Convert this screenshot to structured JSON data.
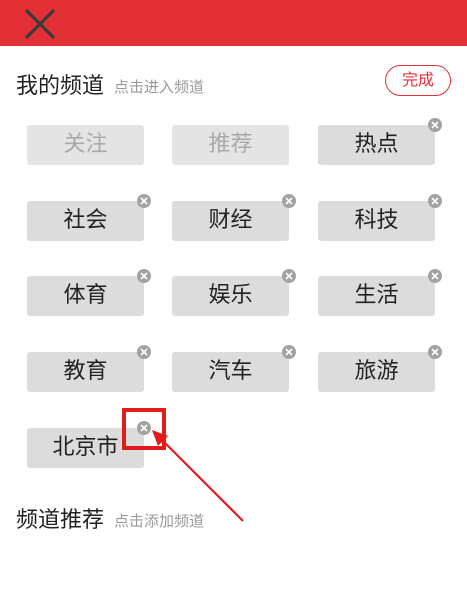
{
  "topbar": {
    "close_icon": "close-icon",
    "color": "#e33036"
  },
  "my_channels": {
    "title": "我的频道",
    "hint": "点击进入频道",
    "done_label": "完成",
    "channels": [
      {
        "label": "关注",
        "fixed": true
      },
      {
        "label": "推荐",
        "fixed": true
      },
      {
        "label": "热点",
        "fixed": false
      },
      {
        "label": "社会",
        "fixed": false
      },
      {
        "label": "财经",
        "fixed": false
      },
      {
        "label": "科技",
        "fixed": false
      },
      {
        "label": "体育",
        "fixed": false
      },
      {
        "label": "娱乐",
        "fixed": false
      },
      {
        "label": "生活",
        "fixed": false
      },
      {
        "label": "教育",
        "fixed": false
      },
      {
        "label": "汽车",
        "fixed": false
      },
      {
        "label": "旅游",
        "fixed": false
      },
      {
        "label": "北京市",
        "fixed": false
      }
    ]
  },
  "recommended_channels": {
    "title": "频道推荐",
    "hint": "点击添加频道"
  },
  "annotation": {
    "highlight_color": "#e21b1b"
  }
}
